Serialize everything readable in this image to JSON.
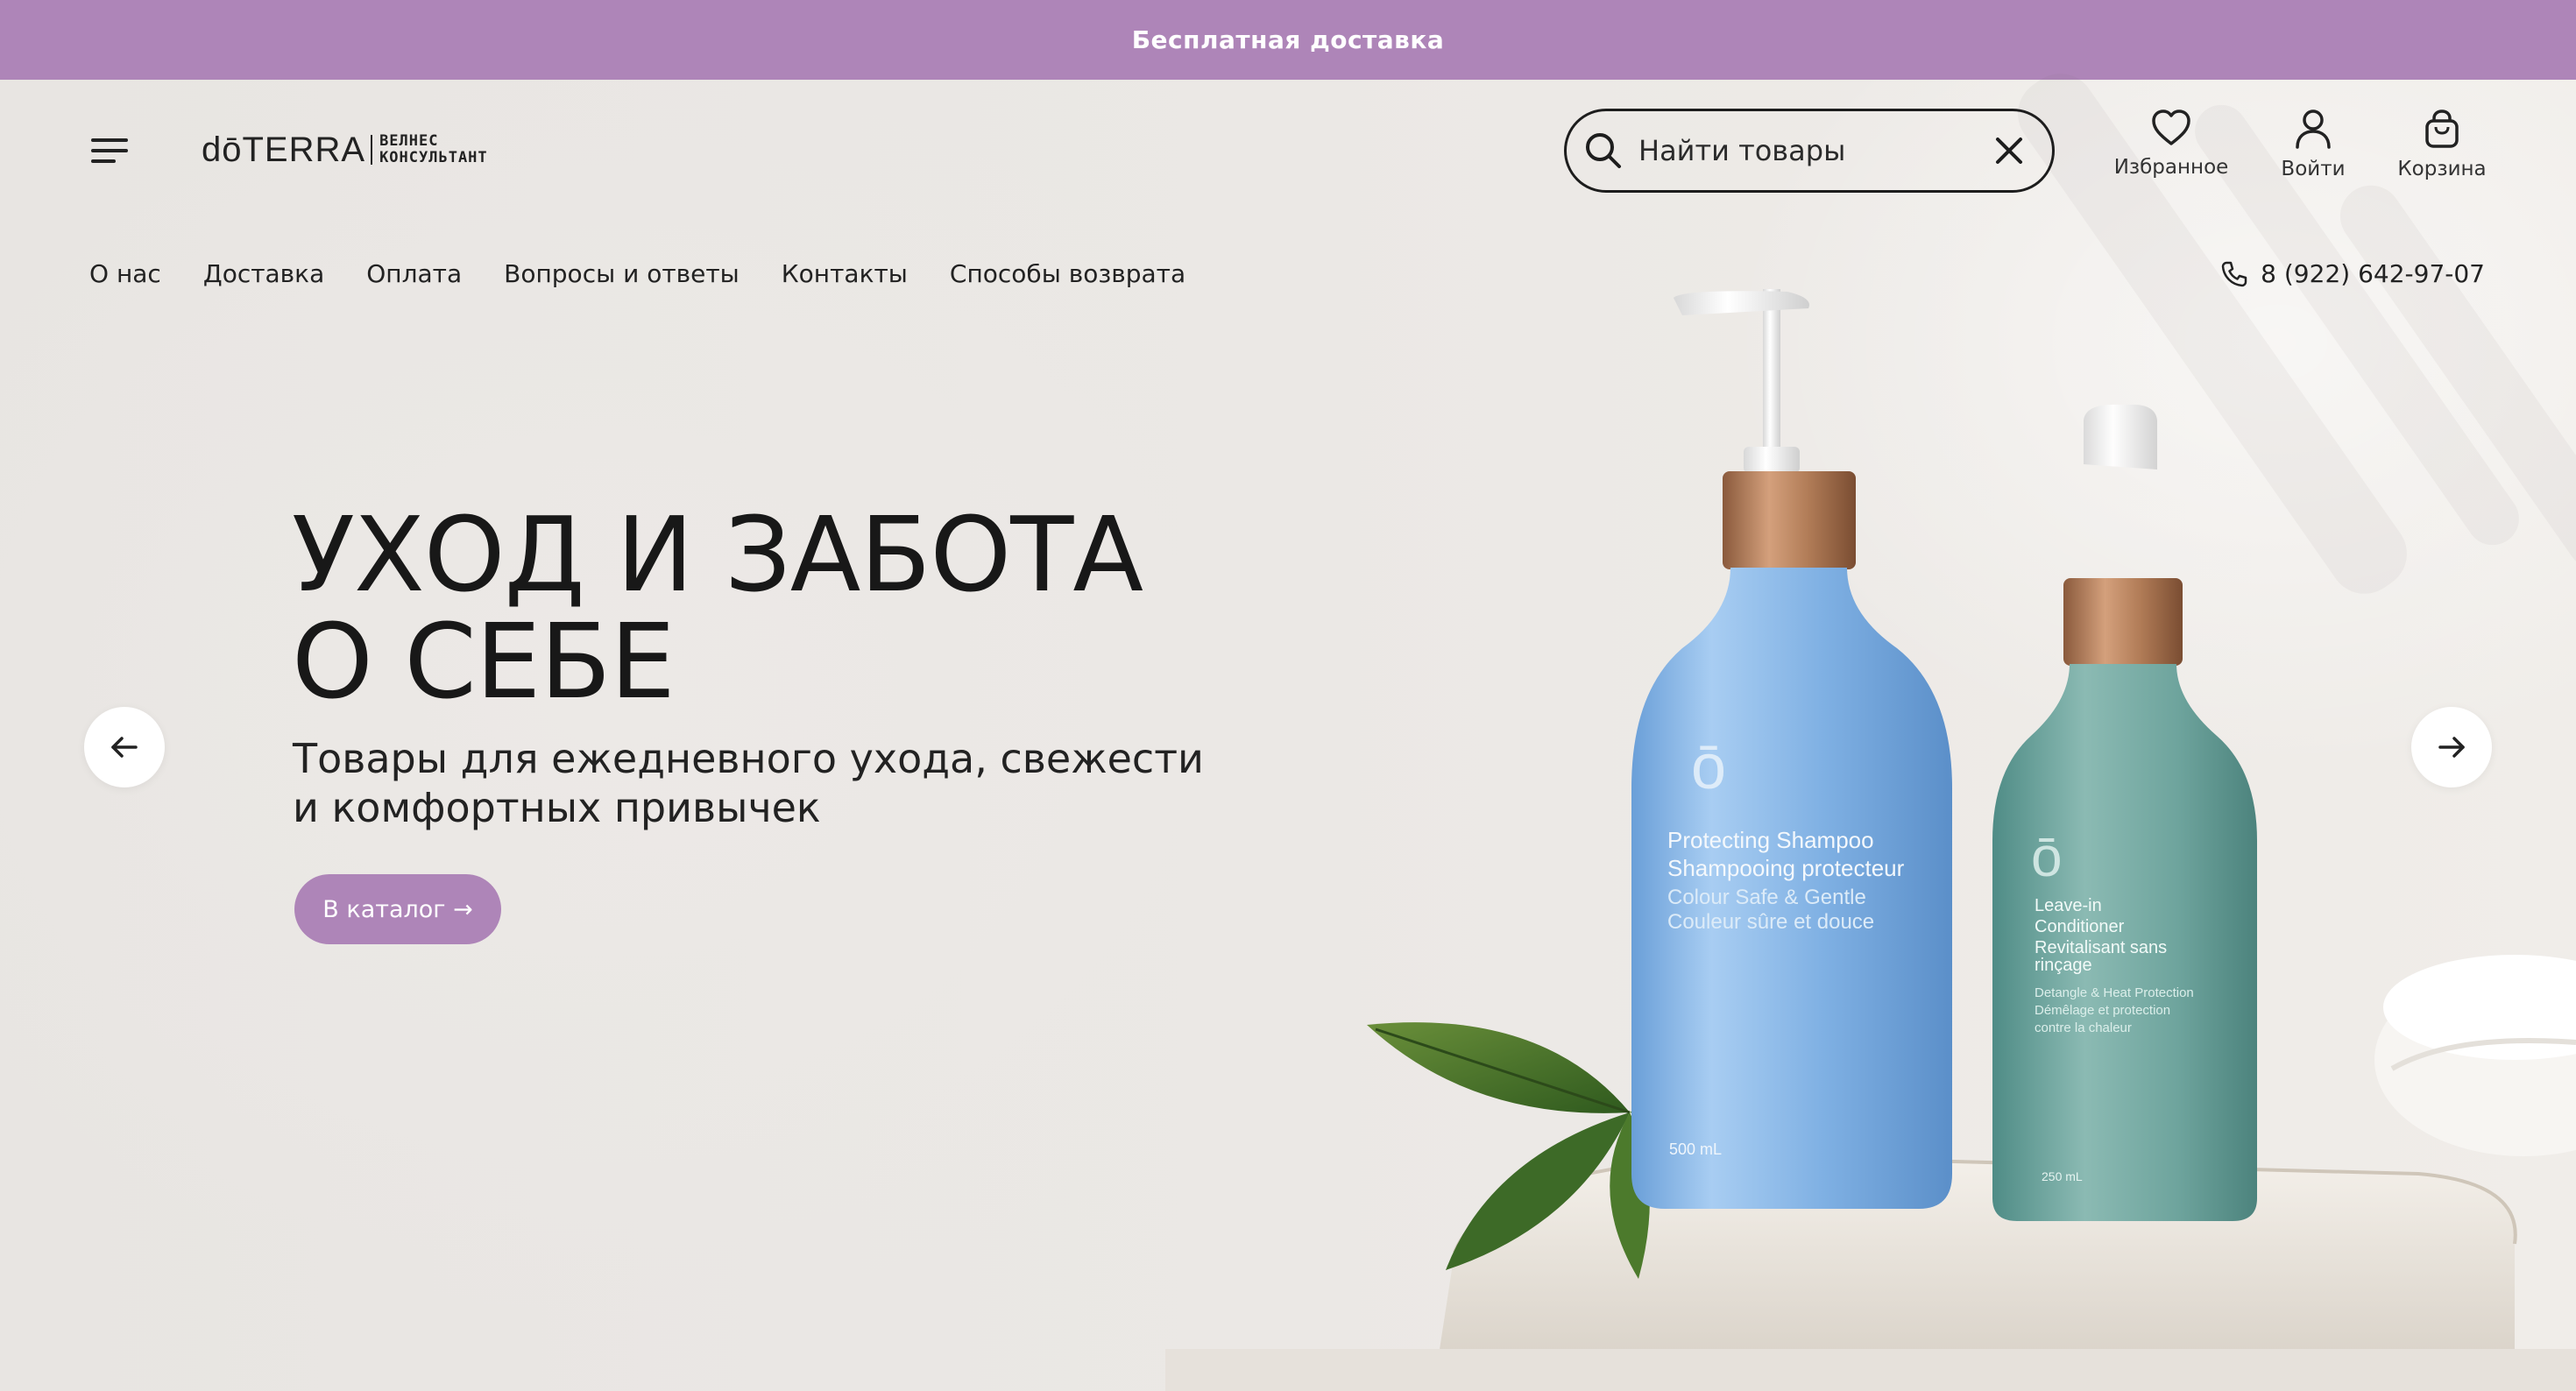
{
  "promo": {
    "text": "Бесплатная доставка"
  },
  "header": {
    "logo_main": "dōTERRA",
    "logo_sub_line1": "ВЕЛНЕС",
    "logo_sub_line2": "КОНСУЛЬТАНТ",
    "search_placeholder": "Найти товары",
    "favorites_label": "Избранное",
    "login_label": "Войти",
    "cart_label": "Корзина"
  },
  "nav": {
    "items": [
      {
        "label": "О нас"
      },
      {
        "label": "Доставка"
      },
      {
        "label": "Оплата"
      },
      {
        "label": "Вопросы и ответы"
      },
      {
        "label": "Контакты"
      },
      {
        "label": "Способы возврата"
      }
    ],
    "phone": "8 (922) 642-97-07"
  },
  "hero": {
    "title_line1": "УХОД И ЗАБОТА",
    "title_line2": "О СЕБЕ",
    "subtitle_line1": "Товары для ежедневного ухода, свежести",
    "subtitle_line2": "и комфортных привычек",
    "cta_label": "В каталог →",
    "bottle1": {
      "line1": "Protecting Shampoo",
      "line2": "Shampooing protecteur",
      "line3": "Colour Safe & Gentle",
      "line4": "Couleur sûre et douce",
      "volume": "500 mL"
    },
    "bottle2": {
      "line1": "Leave-in",
      "line2": "Conditioner",
      "line3": "Revitalisant sans",
      "line4": "rinçage",
      "line5": "Detangle & Heat Protection",
      "line6": "Démêlage et protection",
      "line7": "contre la chaleur",
      "volume": "250 mL"
    }
  },
  "colors": {
    "accent": "#ae85b8",
    "text": "#1b1b1b",
    "background": "#ebe8e5"
  },
  "icons": [
    "menu-icon",
    "search-icon",
    "clear-icon",
    "heart-icon",
    "user-icon",
    "bag-icon",
    "phone-icon",
    "arrow-left-icon",
    "arrow-right-icon"
  ]
}
